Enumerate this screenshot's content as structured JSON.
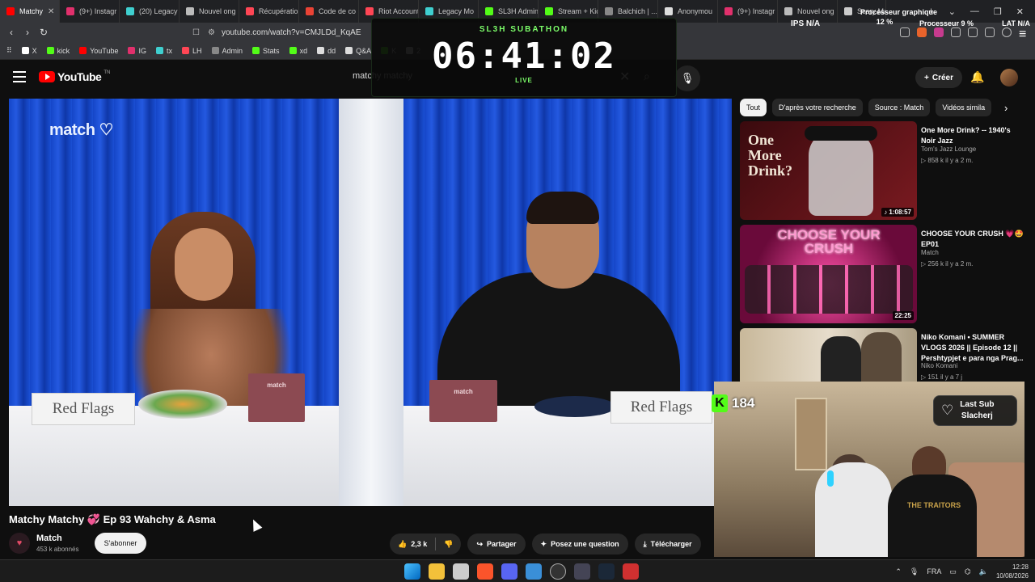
{
  "browser": {
    "tabs": [
      {
        "label": "Matchy",
        "color": "#ff0000",
        "active": true
      },
      {
        "label": "(9+) Instagr",
        "color": "#e1306c"
      },
      {
        "label": "(20) Legacy",
        "color": "#3fcfcf"
      },
      {
        "label": "Nouvel ong",
        "color": "#bbbbbb"
      },
      {
        "label": "Récupératio",
        "color": "#ff4655"
      },
      {
        "label": "Code de co",
        "color": "#ea4335"
      },
      {
        "label": "Riot Account",
        "color": "#ff4655"
      },
      {
        "label": "Legacy Mo",
        "color": "#3fcfcf"
      },
      {
        "label": "SL3H Admin",
        "color": "#53fc18"
      },
      {
        "label": "Stream + Kick",
        "color": "#53fc18"
      },
      {
        "label": "Balchich | ...",
        "color": "#888888"
      },
      {
        "label": "Anonymou",
        "color": "#dddddd"
      },
      {
        "label": "(9+) Instagr",
        "color": "#e1306c"
      },
      {
        "label": "Nouvel ong",
        "color": "#bbbbbb"
      },
      {
        "label": "Scary Maze",
        "color": "#cccccc"
      }
    ],
    "active_tab_close": "✕",
    "new_tab": "+",
    "window_controls": [
      "⌄",
      "—",
      "❐",
      "✕"
    ],
    "url": "youtube.com/watch?v=CMJLDd_KqAE",
    "bookmarks": [
      {
        "label": "X",
        "color": "#ffffff"
      },
      {
        "label": "kick",
        "color": "#53fc18"
      },
      {
        "label": "YouTube",
        "color": "#ff0000"
      },
      {
        "label": "IG",
        "color": "#e1306c"
      },
      {
        "label": "tx",
        "color": "#3fcfcf"
      },
      {
        "label": "LH",
        "color": "#ff4655"
      },
      {
        "label": "Admin",
        "color": "#888888"
      },
      {
        "label": "Stats",
        "color": "#53fc18"
      },
      {
        "label": "xd",
        "color": "#53fc18"
      },
      {
        "label": "dd",
        "color": "#dddddd"
      },
      {
        "label": "Q&A",
        "color": "#dddddd"
      },
      {
        "label": "K",
        "color": "#53fc18"
      },
      {
        "label": "2",
        "color": "#dddddd"
      }
    ]
  },
  "perf_overlay": {
    "processeur_graphique_label": "Processeur graphique",
    "processeur_graphique_value": "12 %",
    "processeur_label": "Processeur",
    "processeur_value": "9 %",
    "lat_label": "LAT",
    "lat_value": "N/A",
    "ips_label": "IPS",
    "ips_value": "N/A"
  },
  "subathon": {
    "title": "SL3H SUBATHON",
    "timer": "06:41:02",
    "status": "LIVE"
  },
  "youtube": {
    "logo_text": "YouTube",
    "logo_tm": "TN",
    "search_value": "matchy matchy",
    "create_label": "Créer",
    "video": {
      "brand_logo": "match",
      "sign_left": "Red Flags",
      "sign_right": "Red Flags",
      "box_label": "match",
      "title": "Matchy Matchy 💞 Ep 93 Wahchy & Asma",
      "channel": "Match",
      "subscribers": "453 k abonnés",
      "subscribe_label": "S'abonner",
      "likes": "2,3 k",
      "share_label": "Partager",
      "ask_label": "Posez une question",
      "download_label": "Télécharger"
    },
    "chips": [
      "Tout",
      "D'après votre recherche",
      "Source : Match",
      "Vidéos simila"
    ],
    "recommendations": [
      {
        "title": "One More Drink? -- 1940's Noir Jazz",
        "channel": "Tom's Jazz Lounge",
        "meta": "▷ 858 k   il y a 2 m.",
        "duration": "1:08:57",
        "thumb_text": "One More Drink?"
      },
      {
        "title": "CHOOSE YOUR CRUSH 💗🤩 EP01",
        "channel": "Match",
        "meta": "▷ 256 k   il y a 2 m.",
        "duration": "22:25",
        "thumb_text": "CHOOSE YOUR CRUSH"
      },
      {
        "title": "Niko Komani • SUMMER VLOGS 2026 || Episode 12 || Pershtypjet e para nga Prag...",
        "channel": "Niko Komani",
        "meta": "▷ 151   il y a 7 j",
        "duration": "",
        "thumb_text": ""
      }
    ]
  },
  "stream_overlay": {
    "kick_letter": "K",
    "viewer_count": "184",
    "last_sub_label": "Last Sub",
    "last_sub_name": "Slacherj",
    "shirt_text": "THE TRAITORS"
  },
  "taskbar": {
    "lang": "FRA",
    "time": "12:28",
    "date": "10/08/2026"
  }
}
